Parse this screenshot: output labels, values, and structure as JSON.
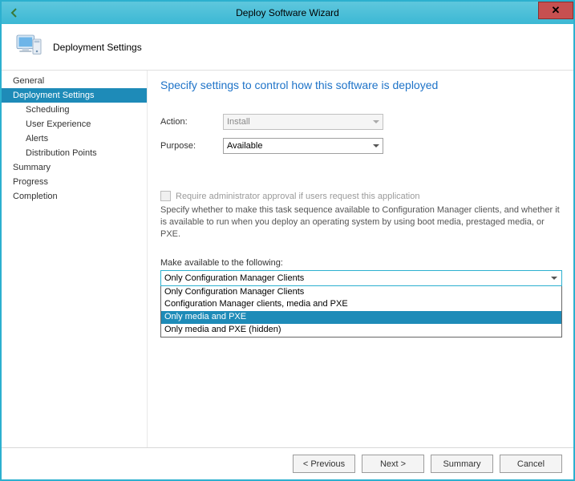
{
  "window": {
    "title": "Deploy Software Wizard",
    "header_title": "Deployment Settings"
  },
  "sidebar": {
    "items": [
      {
        "label": "General",
        "type": "item",
        "active": false
      },
      {
        "label": "Deployment Settings",
        "type": "item",
        "active": true
      },
      {
        "label": "Scheduling",
        "type": "subitem",
        "active": false
      },
      {
        "label": "User Experience",
        "type": "subitem",
        "active": false
      },
      {
        "label": "Alerts",
        "type": "subitem",
        "active": false
      },
      {
        "label": "Distribution Points",
        "type": "subitem",
        "active": false
      },
      {
        "label": "Summary",
        "type": "item",
        "active": false
      },
      {
        "label": "Progress",
        "type": "item",
        "active": false
      },
      {
        "label": "Completion",
        "type": "item",
        "active": false
      }
    ]
  },
  "main": {
    "heading": "Specify settings to control how this software is deployed",
    "action_label": "Action:",
    "action_value": "Install",
    "purpose_label": "Purpose:",
    "purpose_value": "Available",
    "checkbox_label": "Require administrator approval if users request this application",
    "description": "Specify whether to make this task sequence available to Configuration Manager clients, and whether it is available to run when you deploy an operating system by using boot media, prestaged media, or PXE.",
    "available_label": "Make available to the following:",
    "available_selected": "Only Configuration Manager Clients",
    "available_options": [
      "Only Configuration Manager Clients",
      "Configuration Manager clients, media and PXE",
      "Only media and PXE",
      "Only media and PXE (hidden)"
    ],
    "available_highlighted_index": 2
  },
  "footer": {
    "previous": "< Previous",
    "next": "Next >",
    "summary": "Summary",
    "cancel": "Cancel"
  }
}
